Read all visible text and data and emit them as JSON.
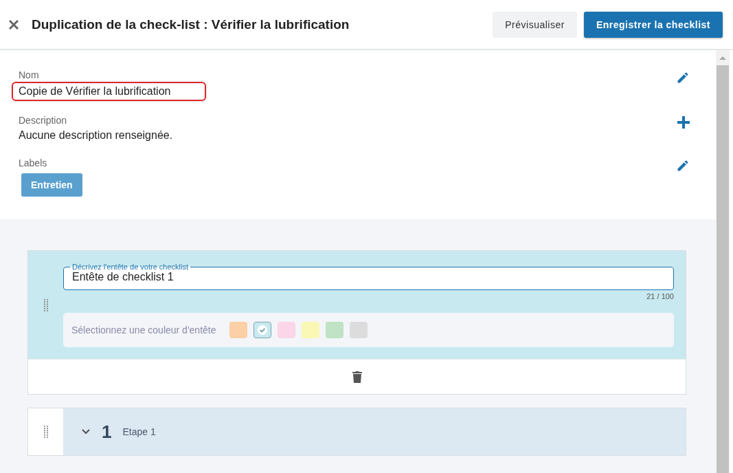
{
  "header": {
    "title": "Duplication de la check-list : Vérifier la lubrification",
    "buttons": [
      {
        "label": "Prévisualiser",
        "kind": "secondary"
      },
      {
        "label": "Enregistrer la checklist",
        "kind": "primary"
      }
    ]
  },
  "fields": [
    {
      "label": "Nom",
      "value": "Copie de Vérifier la lubrification",
      "highlighted": true,
      "kind": "edit"
    },
    {
      "label": "Description",
      "value": "Aucune description renseignée.",
      "highlighted": false,
      "kind": "add"
    },
    {
      "label": "Labels",
      "tags": [
        "Entretien"
      ],
      "kind": "edit"
    }
  ],
  "header_card": {
    "field_label": "Décrivez l'entête de votre checklist",
    "value": "Entête de checklist 1",
    "counter": "21 / 100",
    "color_prompt": "Sélectionnez une couleur d'entête",
    "swatches": [
      {
        "color": "#fcd0a6",
        "selected": false
      },
      {
        "color": "#c8e9ef",
        "selected": true
      },
      {
        "color": "#fbd5e8",
        "selected": false
      },
      {
        "color": "#fbf8b5",
        "selected": false
      },
      {
        "color": "#bfe3c4",
        "selected": false
      },
      {
        "color": "#dcdcdc",
        "selected": false
      }
    ]
  },
  "steps": [
    {
      "number": "1",
      "label": "Etape 1",
      "expanded": false
    }
  ]
}
